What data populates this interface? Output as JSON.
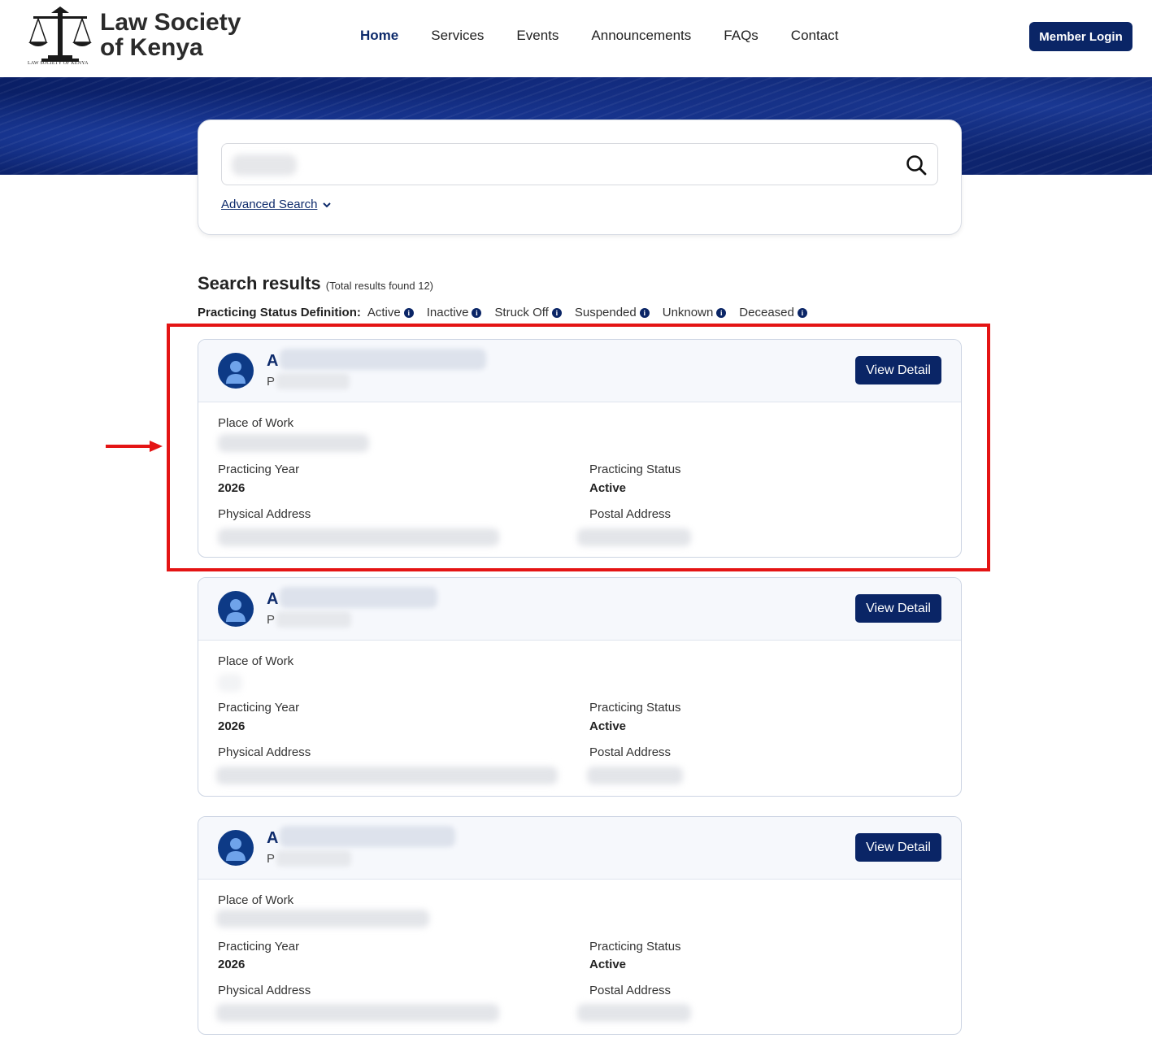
{
  "header": {
    "brand_line1": "Law Society",
    "brand_line2": "of Kenya",
    "logo_caption": "LAW SOCIETY OF KENYA",
    "nav": [
      {
        "label": "Home",
        "active": true
      },
      {
        "label": "Services",
        "active": false
      },
      {
        "label": "Events",
        "active": false
      },
      {
        "label": "Announcements",
        "active": false
      },
      {
        "label": "FAQs",
        "active": false
      },
      {
        "label": "Contact",
        "active": false
      }
    ],
    "login_label": "Member Login"
  },
  "search": {
    "value": "",
    "advanced_label": "Advanced Search"
  },
  "results": {
    "title": "Search results",
    "count_text": "(Total results found 12)",
    "status_definition_label": "Practicing Status Definition:",
    "statuses": [
      "Active",
      "Inactive",
      "Struck Off",
      "Suspended",
      "Unknown",
      "Deceased"
    ]
  },
  "cards": [
    {
      "name_initial": "A",
      "sub_initial": "P",
      "view_label": "View Detail",
      "place_of_work_label": "Place of Work",
      "practicing_year_label": "Practicing Year",
      "practicing_year": "2026",
      "practicing_status_label": "Practicing Status",
      "practicing_status": "Active",
      "physical_address_label": "Physical Address",
      "postal_address_label": "Postal Address"
    },
    {
      "name_initial": "A",
      "sub_initial": "P",
      "view_label": "View Detail",
      "place_of_work_label": "Place of Work",
      "practicing_year_label": "Practicing Year",
      "practicing_year": "2026",
      "practicing_status_label": "Practicing Status",
      "practicing_status": "Active",
      "physical_address_label": "Physical Address",
      "postal_address_label": "Postal Address"
    },
    {
      "name_initial": "A",
      "sub_initial": "P",
      "view_label": "View Detail",
      "place_of_work_label": "Place of Work",
      "practicing_year_label": "Practicing Year",
      "practicing_year": "2026",
      "practicing_status_label": "Practicing Status",
      "practicing_status": "Active",
      "physical_address_label": "Physical Address",
      "postal_address_label": "Postal Address"
    }
  ],
  "colors": {
    "primary": "#0a2566",
    "highlight": "#e41414",
    "banner": "#10287a"
  }
}
